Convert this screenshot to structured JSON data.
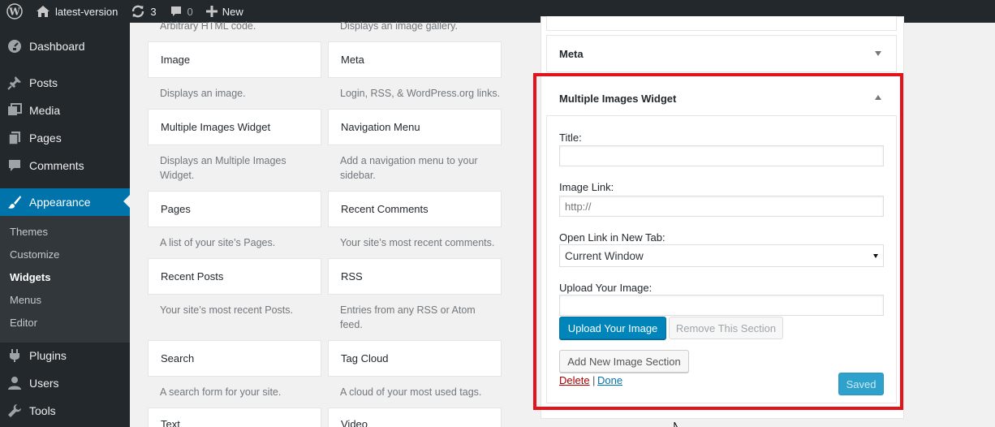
{
  "admin_bar": {
    "site_name": "latest-version",
    "updates_count": "3",
    "comments_count": "0",
    "new_label": "New",
    "icons": [
      "wordpress-icon",
      "home-icon",
      "updates-icon",
      "comment-bubble-icon",
      "plus-icon"
    ]
  },
  "sidebar": {
    "items": [
      {
        "label": "Dashboard",
        "icon": "dashboard-icon"
      },
      {
        "label": "Posts",
        "icon": "pushpin-icon"
      },
      {
        "label": "Media",
        "icon": "media-icon"
      },
      {
        "label": "Pages",
        "icon": "pages-icon"
      },
      {
        "label": "Comments",
        "icon": "comment-icon"
      },
      {
        "label": "Appearance",
        "icon": "paintbrush-icon"
      },
      {
        "label": "Plugins",
        "icon": "plugin-icon"
      },
      {
        "label": "Users",
        "icon": "user-icon"
      },
      {
        "label": "Tools",
        "icon": "wrench-icon"
      }
    ],
    "submenu": [
      "Themes",
      "Customize",
      "Widgets",
      "Menus",
      "Editor"
    ],
    "active_submenu": "Widgets"
  },
  "available_widgets": {
    "top_descriptions": [
      "Arbitrary HTML code.",
      "Displays an image gallery."
    ],
    "widgets": [
      {
        "title": "Image",
        "description": "Displays an image."
      },
      {
        "title": "Meta",
        "description": "Login, RSS, & WordPress.org links."
      },
      {
        "title": "Multiple Images Widget",
        "description": "Displays an Multiple Images Widget."
      },
      {
        "title": "Navigation Menu",
        "description": "Add a navigation menu to your sidebar."
      },
      {
        "title": "Pages",
        "description": "A list of your site’s Pages."
      },
      {
        "title": "Recent Comments",
        "description": "Your site’s most recent comments."
      },
      {
        "title": "Recent Posts",
        "description": "Your site’s most recent Posts."
      },
      {
        "title": "RSS",
        "description": "Entries from any RSS or Atom feed."
      },
      {
        "title": "Search",
        "description": "A search form for your site."
      },
      {
        "title": "Tag Cloud",
        "description": "A cloud of your most used tags."
      },
      {
        "title": "Text",
        "description": ""
      },
      {
        "title": "Video",
        "description": ""
      }
    ]
  },
  "sidebar_area": {
    "meta_widget_title": "Meta",
    "expanded_widget": {
      "title": "Multiple Images Widget",
      "fields": {
        "title_label": "Title:",
        "title_value": "",
        "image_link_label": "Image Link:",
        "image_link_placeholder": "http://",
        "open_link_label": "Open Link in New Tab:",
        "open_link_selected": "Current Window",
        "upload_label": "Upload Your Image:",
        "upload_value": ""
      },
      "buttons": {
        "upload": "Upload Your Image",
        "remove_section": "Remove This Section",
        "add_section": "Add New Image Section",
        "saved": "Saved"
      },
      "links": {
        "delete": "Delete",
        "separator": "|",
        "done": "Done"
      }
    }
  },
  "colors": {
    "admin_bar_bg": "#23282d",
    "accent": "#0073aa",
    "highlight_border": "#e4121b",
    "delete_link": "#a00000"
  }
}
